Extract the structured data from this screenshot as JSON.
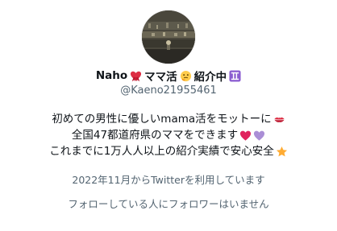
{
  "profile": {
    "name": "Naho",
    "name_suffix_1": "ママ活",
    "name_suffix_2": "紹介中",
    "handle": "@Kaeno21955461",
    "bio_lines": [
      "初めての男性に優しいmama活をモットーに",
      "全国47都道府県のママをできます",
      "これまでに1万人人以上の紹介実績で安心安全"
    ],
    "joined": "2022年11月からTwitterを利用しています",
    "follow_note": "フォローしている人にフォロワーはいません"
  },
  "icons": {
    "avatar": "profile-photo",
    "name_emojis": [
      "heart-ribbon-icon",
      "thinking-face-icon",
      "gemini-icon"
    ],
    "bio_emojis": [
      "kiss-mark-icon",
      "red-heart-icon",
      "purple-heart-icon",
      "star-icon"
    ]
  },
  "colors": {
    "text_primary": "#0f1419",
    "text_secondary": "#536471",
    "gemini_bg": "#8a5cd0",
    "heart_red": "#e0245e",
    "heart_purple": "#aa8ed6",
    "star": "#ffac33"
  }
}
